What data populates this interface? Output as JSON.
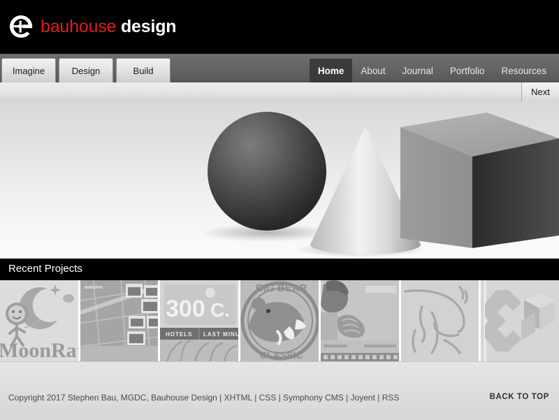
{
  "site": {
    "logo_icon": "bauhouse-circle-e-icon",
    "brand_first": "bauhouse",
    "brand_second": " design",
    "brand_color": "#e8191e"
  },
  "nav": {
    "left_tabs": [
      {
        "label": "Imagine"
      },
      {
        "label": "Design"
      },
      {
        "label": "Build"
      }
    ],
    "right_items": [
      {
        "label": "Home",
        "active": true
      },
      {
        "label": "About",
        "active": false
      },
      {
        "label": "Journal",
        "active": false
      },
      {
        "label": "Portfolio",
        "active": false
      },
      {
        "label": "Resources",
        "active": false
      }
    ]
  },
  "subbar": {
    "next_label": "Next"
  },
  "hero": {
    "shapes": [
      {
        "name": "sphere",
        "fill_light": "#6d6d6d",
        "fill_dark": "#262626"
      },
      {
        "name": "cone",
        "fill_light": "#f0f0f0",
        "fill_dark": "#9a9a9a"
      },
      {
        "name": "cube",
        "top": "#a9a9a9",
        "left": "#949494",
        "right": "#3a3a3a"
      }
    ]
  },
  "recent": {
    "heading": "Recent Projects",
    "thumbnails": [
      {
        "name": "moonrat-project",
        "caption": "MoonRat"
      },
      {
        "name": "map-photos-project",
        "caption": ""
      },
      {
        "name": "300c-hotels-project",
        "caption": "300°C."
      },
      {
        "name": "big-bear-classic-project",
        "caption": "BIG BEAR CLASSIC"
      },
      {
        "name": "prayer-photo-project",
        "caption": ""
      },
      {
        "name": "horse-lineart-project",
        "caption": ""
      },
      {
        "name": "isometric-logo-project",
        "caption": ""
      }
    ],
    "thumb_labels": {
      "t3_hotels": "HOTELS",
      "t3_lastminute": "LAST MINUT",
      "t3_title": "300",
      "t3_suffix": "C.",
      "t4_top": "BIG BEAR",
      "t4_bottom": "CLASSIC",
      "t1_caption": "MoonRat"
    }
  },
  "footer": {
    "copyright": "Copyright 2017 Stephen Bau, MGDC, Bauhouse Design | XHTML | CSS | Symphony CMS | Joyent | RSS",
    "back_to_top": "BACK TO TOP"
  }
}
